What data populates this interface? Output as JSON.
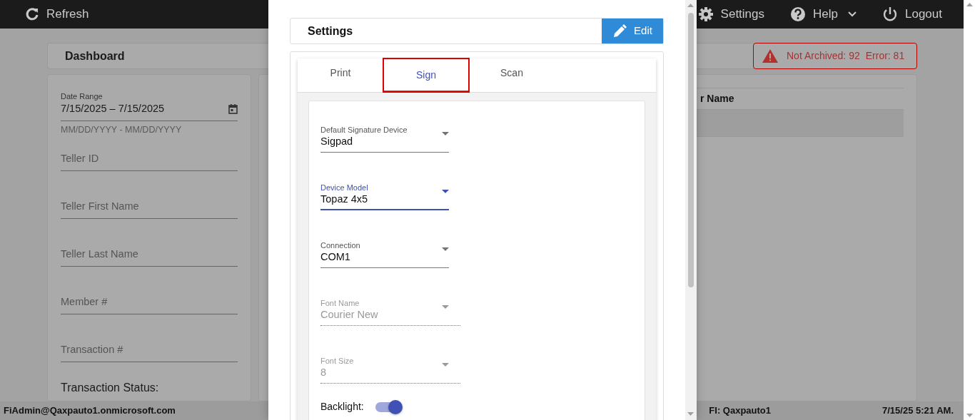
{
  "top_bar": {
    "left": [
      {
        "kind": "refresh",
        "label": "Refresh"
      }
    ],
    "right": [
      {
        "kind": "settings",
        "label": "Settings"
      },
      {
        "kind": "help",
        "label": "Help"
      },
      {
        "kind": "logout",
        "label": "Logout"
      }
    ]
  },
  "dashboard": {
    "title": "Dashboard",
    "alert": [
      "Not Archived: 92",
      "Error: 81"
    ]
  },
  "filters": {
    "date_range": {
      "label": "Date Range",
      "value": "7/15/2025 – 7/15/2025",
      "hint": "MM/DD/YYYY - MM/DD/YYYY"
    },
    "fields": [
      {
        "placeholder": "Teller ID"
      },
      {
        "placeholder": "Teller First Name"
      },
      {
        "placeholder": "Teller Last Name"
      },
      {
        "placeholder": "Member #"
      },
      {
        "placeholder": "Transaction #"
      }
    ],
    "status_label": "Transaction Status:"
  },
  "table": {
    "columns": [
      "r Name"
    ]
  },
  "status_bar": {
    "user": "FiAdmin@Qaxpauto1.onmicrosoft.com",
    "fi": "FI: Qaxpauto1",
    "time": "7/15/25 5:21 AM."
  },
  "modal": {
    "title": "Settings",
    "edit_button": "Edit",
    "tabs": [
      {
        "label": "Print",
        "selected": false,
        "focused": false
      },
      {
        "label": "Sign",
        "selected": true,
        "focused": true
      },
      {
        "label": "Scan",
        "selected": false,
        "focused": false
      }
    ],
    "fields": [
      {
        "label": "Default Signature Device",
        "value": "Sigpad",
        "focused": false,
        "disabled": false
      },
      {
        "label": "Device Model",
        "value": "Topaz 4x5",
        "focused": true,
        "disabled": false
      },
      {
        "label": "Connection",
        "value": "COM1",
        "focused": false,
        "disabled": false
      },
      {
        "label": "Font Name",
        "value": "Courier New",
        "focused": false,
        "disabled": true
      },
      {
        "label": "Font Size",
        "value": "8",
        "focused": false,
        "disabled": true
      }
    ],
    "backlight": {
      "label": "Backlight:",
      "on": true
    }
  }
}
